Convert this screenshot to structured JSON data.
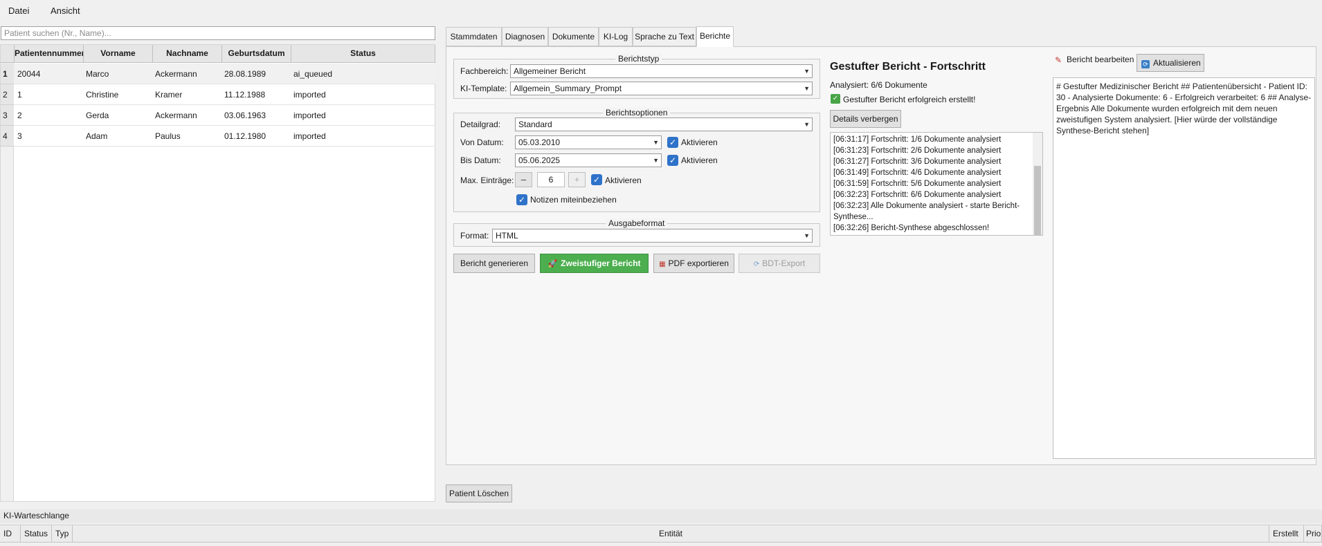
{
  "menu": {
    "items": [
      "Datei",
      "Ansicht"
    ]
  },
  "search": {
    "placeholder": "Patient suchen (Nr., Name)..."
  },
  "patient_table": {
    "columns": [
      "Patientennummer",
      "Vorname",
      "Nachname",
      "Geburtsdatum",
      "Status"
    ],
    "row_numbers": [
      "1",
      "2",
      "3",
      "4"
    ],
    "rows": [
      [
        "20044",
        "Marco",
        "Ackermann",
        "28.08.1989",
        "ai_queued"
      ],
      [
        "1",
        "Christine",
        "Kramer",
        "11.12.1988",
        "imported"
      ],
      [
        "2",
        "Gerda",
        "Ackermann",
        "03.06.1963",
        "imported"
      ],
      [
        "3",
        "Adam",
        "Paulus",
        "01.12.1980",
        "imported"
      ]
    ]
  },
  "delete_button": "Patient Löschen",
  "tabs": [
    "Stammdaten",
    "Diagnosen",
    "Dokumente",
    "KI-Log",
    "Sprache zu Text",
    "Berichte"
  ],
  "active_tab": "Berichte",
  "berichtstyp": {
    "title": "Berichtstyp",
    "fachbereich_label": "Fachbereich:",
    "fachbereich_value": "Allgemeiner Bericht",
    "template_label": "KI-Template:",
    "template_value": "Allgemein_Summary_Prompt"
  },
  "berichtsoptionen": {
    "title": "Berichtsoptionen",
    "detailgrad_label": "Detailgrad:",
    "detailgrad_value": "Standard",
    "von_label": "Von Datum:",
    "von_value": "05.03.2010",
    "von_check_label": "Aktivieren",
    "bis_label": "Bis Datum:",
    "bis_value": "05.06.2025",
    "bis_check_label": "Aktivieren",
    "max_label": "Max. Einträge:",
    "max_minus": "–",
    "max_value": "6",
    "max_plus": "+",
    "max_check_label": "Aktivieren",
    "notes_label": "Notizen miteinbeziehen",
    "checked": {
      "von": true,
      "bis": true,
      "max": true,
      "notes": true
    }
  },
  "ausgabeformat": {
    "title": "Ausgabeformat",
    "format_label": "Format:",
    "format_value": "HTML"
  },
  "actions": {
    "generate": "Bericht generieren",
    "twostep": "Zweistufiger Bericht",
    "pdf": "PDF exportieren",
    "bdt": "BDT-Export"
  },
  "progress": {
    "title": "Gestufter Bericht - Fortschritt",
    "analysed": "Analysiert: 6/6 Dokumente",
    "success": "Gestufter Bericht erfolgreich erstellt!",
    "details_button": "Details verbergen",
    "log": [
      "[06:31:17] Fortschritt: 1/6 Dokumente analysiert",
      "[06:31:23] Fortschritt: 2/6 Dokumente analysiert",
      "[06:31:27] Fortschritt: 3/6 Dokumente analysiert",
      "[06:31:49] Fortschritt: 4/6 Dokumente analysiert",
      "[06:31:59] Fortschritt: 5/6 Dokumente analysiert",
      "[06:32:23] Fortschritt: 6/6 Dokumente analysiert",
      "[06:32:23] Alle Dokumente analysiert - starte Bericht-Synthese...",
      "[06:32:26] Bericht-Synthese abgeschlossen!"
    ]
  },
  "editor": {
    "label": "Bericht bearbeiten",
    "refresh_button": "Aktualisieren",
    "content": "# Gestufter Medizinischer Bericht ## Patientenübersicht - Patient ID: 30 - Analysierte Dokumente: 6 - Erfolgreich verarbeitet: 6 ## Analyse-Ergebnis Alle Dokumente wurden erfolgreich mit dem neuen zweistufigen System analysiert. [Hier würde der vollständige Synthese-Bericht stehen]"
  },
  "queue": {
    "label": "KI-Warteschlange",
    "columns": [
      "ID",
      "Status",
      "Typ",
      "Entität",
      "Erstellt",
      "Prio"
    ]
  },
  "colors": {
    "accent": "#2f72c9",
    "success": "#4cae4f"
  }
}
